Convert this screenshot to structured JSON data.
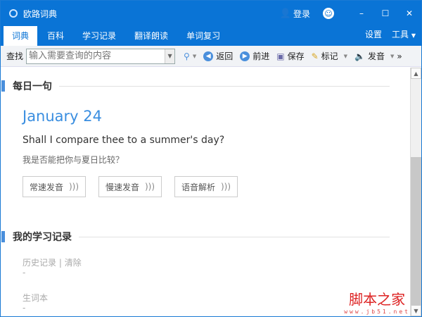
{
  "app": {
    "title": "欧路词典",
    "login": "登录"
  },
  "tabs": [
    "词典",
    "百科",
    "学习记录",
    "翻译朗读",
    "单词复习"
  ],
  "tabs_right": {
    "settings": "设置",
    "tools": "工具"
  },
  "toolbar": {
    "find": "查找",
    "placeholder": "输入需要查询的内容",
    "back": "返回",
    "forward": "前进",
    "save": "保存",
    "mark": "标记",
    "speak": "发音"
  },
  "daily": {
    "heading": "每日一句",
    "date": "January 24",
    "english": "Shall I compare thee to a summer's day?",
    "chinese": "我是否能把你与夏日比较？",
    "buttons": [
      "常速发音",
      "慢速发音",
      "语音解析"
    ]
  },
  "records": {
    "heading": "我的学习记录",
    "history": "历史记录",
    "clear": "清除",
    "history_value": "-",
    "vocab": "生词本",
    "vocab_value": "-"
  },
  "watermark": {
    "text": "脚本之家",
    "url": "www.jb51.net"
  }
}
